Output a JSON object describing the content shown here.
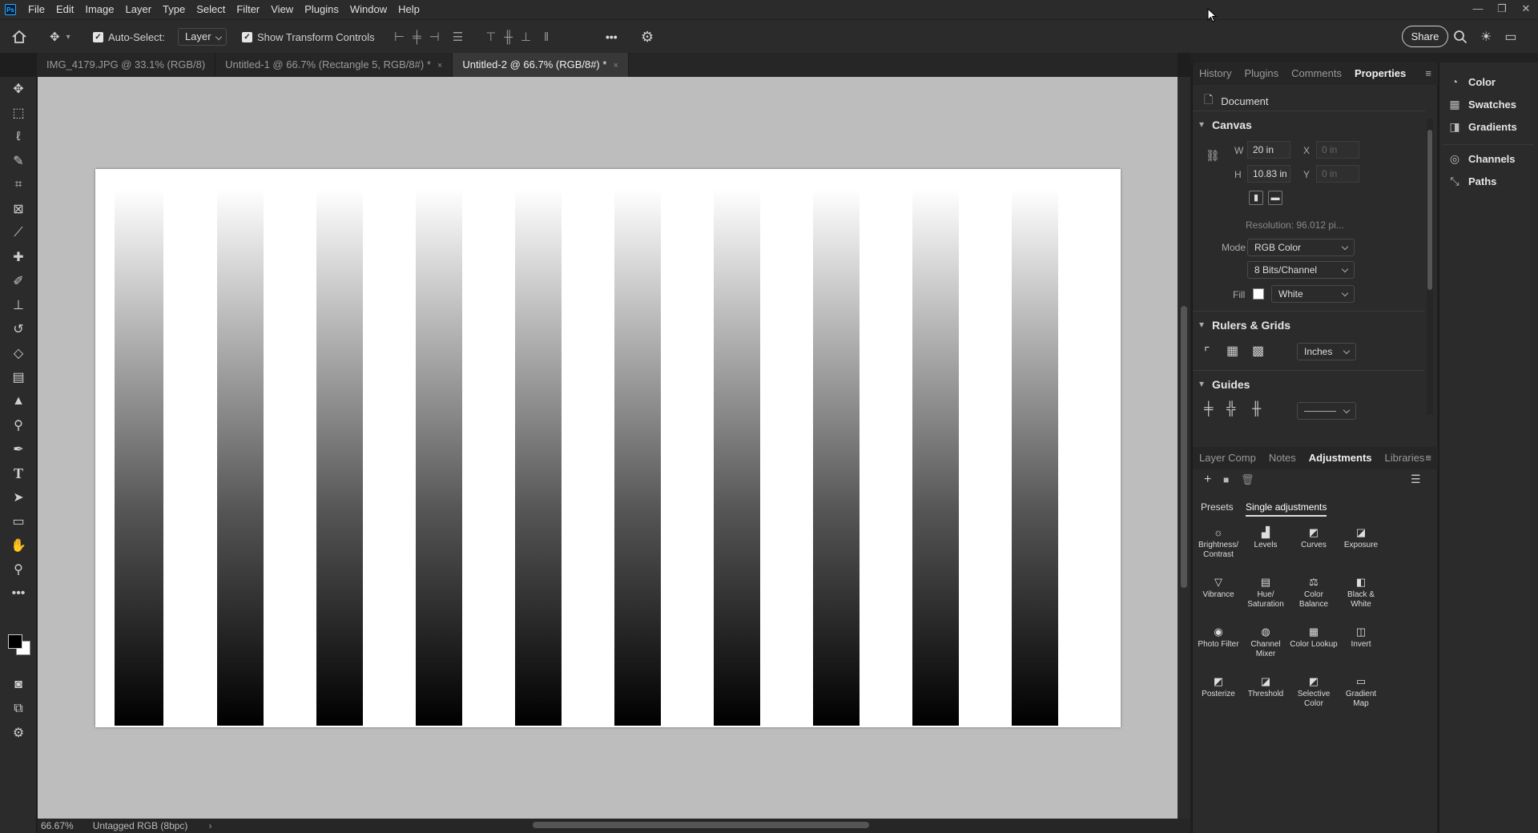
{
  "menubar": {
    "logo": "Ps",
    "items": [
      "File",
      "Edit",
      "Image",
      "Layer",
      "Type",
      "Select",
      "Filter",
      "View",
      "Plugins",
      "Window",
      "Help"
    ],
    "window_controls": [
      "—",
      "❐",
      "✕"
    ]
  },
  "options": {
    "auto_select_label": "Auto-Select:",
    "auto_select_value": "Layer",
    "transform_label": "Show Transform Controls",
    "more_label": "•••",
    "share_label": "Share"
  },
  "tabs": [
    {
      "label": "IMG_4179.JPG @ 33.1% (RGB/8)",
      "close": "×"
    },
    {
      "label": "Untitled-1 @ 66.7% (Rectangle 5, RGB/8#) *",
      "close": "×"
    },
    {
      "label": "Untitled-2 @ 66.7% (RGB/8#) *",
      "close": "×"
    }
  ],
  "status": {
    "zoom": "66.67%",
    "profile": "Untagged RGB (8bpc)",
    "arrow": "›"
  },
  "properties_panel": {
    "tabs": [
      "History",
      "Plugins",
      "Comments",
      "Properties"
    ],
    "active_tab": "Properties",
    "doc_label": "Document",
    "canvas_title": "Canvas",
    "w_label": "W",
    "w_value": "20 in",
    "h_label": "H",
    "h_value": "10.83 in",
    "x_label": "X",
    "x_value": "0 in",
    "y_label": "Y",
    "y_value": "0 in",
    "resolution": "Resolution: 96.012 pi...",
    "mode_label": "Mode",
    "mode_value": "RGB Color",
    "bits_value": "8 Bits/Channel",
    "fill_label": "Fill",
    "fill_value": "White",
    "rulers_title": "Rulers & Grids",
    "units_value": "Inches",
    "guides_title": "Guides"
  },
  "adjustments_panel": {
    "tabs": [
      "Layer Comp",
      "Notes",
      "Adjustments",
      "Libraries"
    ],
    "active_tab": "Adjustments",
    "subtabs": [
      "Presets",
      "Single adjustments"
    ],
    "items": [
      {
        "label": "Brightness/ Contrast",
        "icon": "☼"
      },
      {
        "label": "Levels",
        "icon": "▟"
      },
      {
        "label": "Curves",
        "icon": "◩"
      },
      {
        "label": "Exposure",
        "icon": "◪"
      },
      {
        "label": "Vibrance",
        "icon": "▽"
      },
      {
        "label": "Hue/ Saturation",
        "icon": "▤"
      },
      {
        "label": "Color Balance",
        "icon": "⚖"
      },
      {
        "label": "Black & White",
        "icon": "◧"
      },
      {
        "label": "Photo Filter",
        "icon": "◉"
      },
      {
        "label": "Channel Mixer",
        "icon": "◍"
      },
      {
        "label": "Color Lookup",
        "icon": "▦"
      },
      {
        "label": "Invert",
        "icon": "◫"
      },
      {
        "label": "Posterize",
        "icon": "◩"
      },
      {
        "label": "Threshold",
        "icon": "◪"
      },
      {
        "label": "Selective Color",
        "icon": "◩"
      },
      {
        "label": "Gradient Map",
        "icon": "▭"
      }
    ]
  },
  "dock": {
    "items": [
      {
        "label": "Color",
        "icon": "◔"
      },
      {
        "label": "Swatches",
        "icon": "▦"
      },
      {
        "label": "Gradients",
        "icon": "◨"
      },
      {
        "label": "Channels",
        "icon": "◎"
      },
      {
        "label": "Paths",
        "icon": "⤡"
      }
    ]
  },
  "colors": {
    "foreground": "#000000",
    "background": "#ffffff",
    "canvas_bg": "#ffffff",
    "workspace_bg": "#bdbdbd"
  }
}
